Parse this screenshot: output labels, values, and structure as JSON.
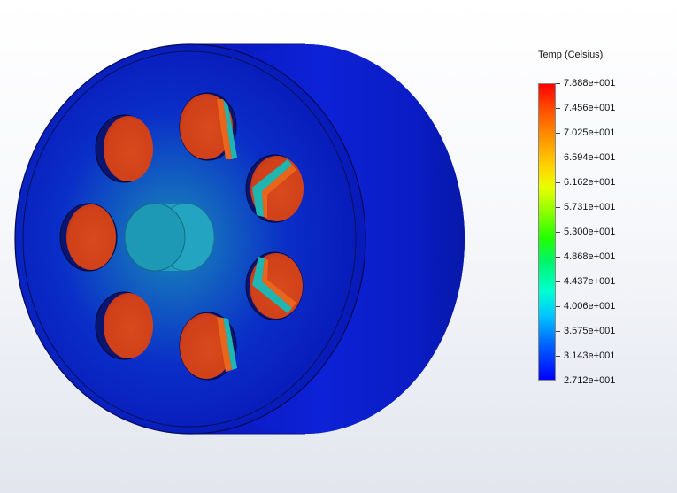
{
  "legend": {
    "title": "Temp (Celsius)",
    "ticks": [
      "7.888e+001",
      "7.456e+001",
      "7.025e+001",
      "6.594e+001",
      "6.162e+001",
      "5.731e+001",
      "5.300e+001",
      "4.868e+001",
      "4.437e+001",
      "4.006e+001",
      "3.575e+001",
      "3.143e+001",
      "2.712e+001"
    ],
    "max_celsius": 78.88,
    "min_celsius": 27.12,
    "colormap": [
      "#ff0000",
      "#ff8c00",
      "#ffd400",
      "#9cff00",
      "#23ff00",
      "#00ffd0",
      "#00c8ff",
      "#0064ff",
      "#0000ff"
    ]
  },
  "model": {
    "body_color": "#0a1fc8",
    "hub_color": "#1f9fb8",
    "hot_color": "#d8401a"
  }
}
